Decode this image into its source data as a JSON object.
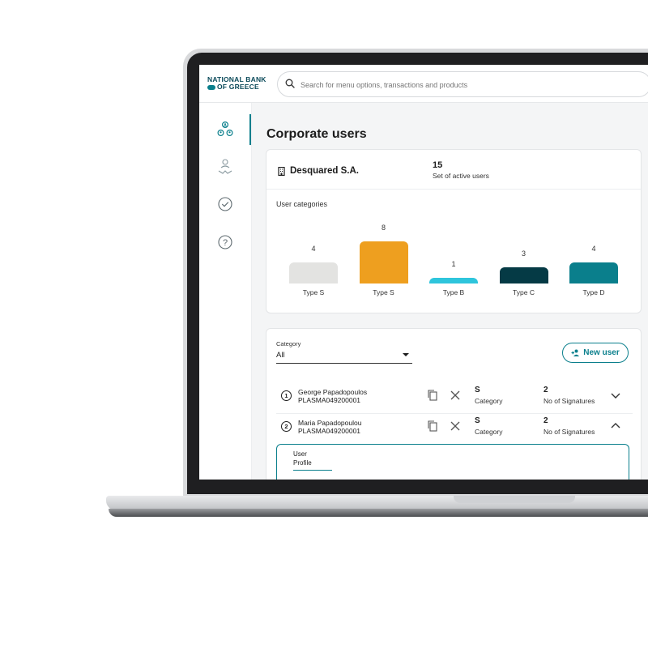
{
  "app": {
    "logo_line1": "NATIONAL BANK",
    "logo_line2": "OF GREECE",
    "search_placeholder": "Search for menu options, transactions and products"
  },
  "sidebar": {
    "items": [
      {
        "icon": "users-group-icon",
        "active": true
      },
      {
        "icon": "user-approval-icon",
        "active": false
      },
      {
        "icon": "check-circle-icon",
        "active": false
      },
      {
        "icon": "help-icon",
        "active": false
      }
    ]
  },
  "page": {
    "title": "Corporate users"
  },
  "summary": {
    "company": "Desquared S.A.",
    "active_count": "15",
    "active_label": "Set of active users",
    "categories_title": "User categories"
  },
  "chart_data": {
    "type": "bar",
    "categories": [
      "Type S",
      "Type S",
      "Type B",
      "Type C",
      "Type D"
    ],
    "values": [
      4,
      8,
      1,
      3,
      4
    ],
    "colors": [
      "#e3e3e1",
      "#ee9f1f",
      "#2ec5dc",
      "#053a45",
      "#0a7f8c"
    ],
    "title": "User categories",
    "xlabel": "",
    "ylabel": "",
    "ylim": [
      0,
      8
    ]
  },
  "users_panel": {
    "category_label": "Category",
    "category_value": "All",
    "new_user_label": "New user",
    "rows": [
      {
        "index": "1",
        "name": "George Papadopoulos",
        "id": "PLASMA049200001",
        "category": "S",
        "category_label": "Category",
        "signatures": "2",
        "signatures_label": "No of Signatures",
        "expanded": false
      },
      {
        "index": "2",
        "name": "Maria Papadopoulou",
        "id": "PLASMA049200001",
        "category": "S",
        "category_label": "Category",
        "signatures": "2",
        "signatures_label": "No of Signatures",
        "expanded": true
      }
    ],
    "profile_tab_line1": "User",
    "profile_tab_line2": "Profile"
  },
  "colors": {
    "accent": "#0a7f8c",
    "dark_teal": "#053a45",
    "orange": "#ee9f1f",
    "cyan": "#2ec5dc",
    "light_gray": "#e3e3e1"
  }
}
